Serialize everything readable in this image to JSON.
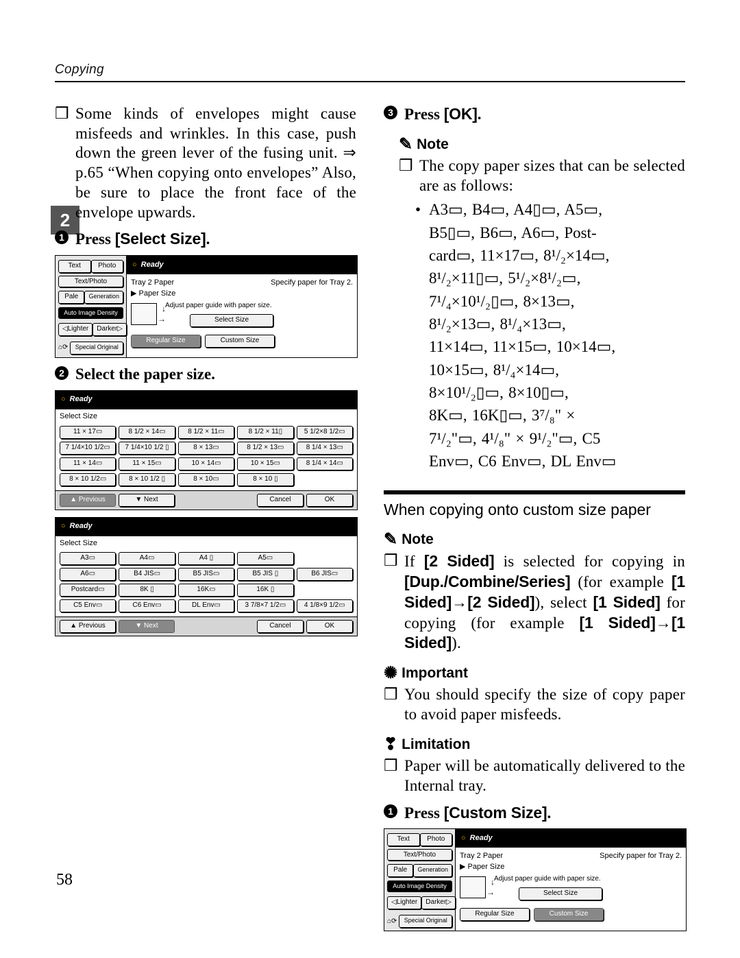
{
  "header": {
    "running_head": "Copying",
    "page_number": "58",
    "chapter_tab": "2"
  },
  "left": {
    "envelope_note": "Some kinds of envelopes might cause misfeeds and wrinkles. In this case, push down the green lever of the fusing unit. ⇒ p.65 “When copying onto envelopes” Also, be sure to place the front face of the envelope upwards.",
    "step1": {
      "prefix": "Press ",
      "bold": "[Select Size]",
      "suffix": "."
    },
    "step2": {
      "text": "Select the paper size."
    },
    "panel1": {
      "ready": "Ready",
      "side": {
        "seg_text": "Text",
        "seg_photo": "Photo",
        "btn_textphoto": "Text/Photo",
        "btn_pale": "Pale",
        "btn_generation": "Generation",
        "btn_aid": "Auto Image Density",
        "btn_lighter": "◁Lighter",
        "btn_darker": "Darker▷",
        "btn_special": "Special Original",
        "recall_icon": "⌂⟳"
      },
      "main": {
        "tray_label": "Tray 2 Paper",
        "specify": "Specify paper for Tray 2.",
        "paper_size_label": "Paper Size",
        "adjust_hint": "Adjust paper guide with paper size.",
        "btn_select_size": "Select Size",
        "btn_regular": "Regular Size",
        "btn_custom": "Custom Size"
      }
    },
    "panel2": {
      "ready": "Ready",
      "select_size_label": "Select Size",
      "grid": [
        "11 × 17▭",
        "8 1/2 × 14▭",
        "8 1/2 × 11▭",
        "8 1/2 × 11▯",
        "5 1/2×8 1/2▭",
        "7 1/4×10 1/2▭",
        "7 1/4×10 1/2 ▯",
        "8 × 13▭",
        "8 1/2 × 13▭",
        "8 1/4 × 13▭",
        "11 × 14▭",
        "11 × 15▭",
        "10 × 14▭",
        "10 × 15▭",
        "8 1/4 × 14▭",
        "8 × 10 1/2▭",
        "8 × 10 1/2 ▯",
        "8 × 10▭",
        "8 × 10 ▯",
        ""
      ],
      "btn_prev": "▲ Previous",
      "btn_next": "▼ Next",
      "btn_cancel": "Cancel",
      "btn_ok": "OK"
    },
    "panel3": {
      "ready": "Ready",
      "select_size_label": "Select Size",
      "grid": [
        "A3▭",
        "A4▭",
        "A4 ▯",
        "A5▭",
        "",
        "A6▭",
        "B4 JIS▭",
        "B5 JIS▭",
        "B5 JIS ▯",
        "B6 JIS▭",
        "Postcard▭",
        "8K ▯",
        "16K▭",
        "16K ▯",
        "",
        "C5 Env▭",
        "C6 Env▭",
        "DL Env▭",
        "3 7/8×7 1/2▭",
        "4 1/8×9 1/2▭"
      ],
      "btn_prev": "▲ Previous",
      "btn_next": "▼ Next",
      "btn_cancel": "Cancel",
      "btn_ok": "OK"
    }
  },
  "right": {
    "step3": {
      "prefix": "Press ",
      "bold": "[OK]",
      "suffix": "."
    },
    "note_label": "Note",
    "note_after_step3": "The copy paper sizes that can be selected are as follows:",
    "size_list_lines": [
      "A3▭, B4▭, A4▯▭, A5▭,",
      "B5▯▭, B6▭, A6▭, Post-",
      "card▭, 11×17▭, 8¹/₂×14▭,",
      "8¹/₂×11▯▭, 5¹/₂×8¹/₂▭,",
      "7¹/₄×10¹/₂▯▭, 8×13▭,",
      "8¹/₂×13▭, 8¹/₄×13▭,",
      "11×14▭, 11×15▭, 10×14▭,",
      "10×15▭, 8¹/₄×14▭,",
      "8×10¹/₂▯▭, 8×10▯▭,",
      "8K▭, 16K▯▭, 3⁷/₈\" ×",
      "7¹/₂\"▭, 4¹/₈\" × 9¹/₂\"▭, C5",
      "Env▭, C6 Env▭, DL Env▭"
    ],
    "custom_heading": "When copying onto custom size paper",
    "note2_text_parts": {
      "a": "If ",
      "b": "[2 Sided]",
      "c": " is selected for copying in ",
      "d": "[Dup./Combine/Series]",
      "e": " (for example ",
      "f": "[1 Sided]",
      "g": "→",
      "h": "[2 Sided]",
      "i": "), select ",
      "j": "[1 Sided]",
      "k": " for copying (for example ",
      "l": "[1 Sided]",
      "m": "→",
      "n": "[1 Sided]",
      "o": ")."
    },
    "important_label": "Important",
    "important_text": "You should specify the size of copy paper to avoid paper misfeeds.",
    "limitation_label": "Limitation",
    "limitation_text": "Paper will be automatically delivered to the Internal tray.",
    "step1": {
      "prefix": "Press ",
      "bold": "[Custom Size]",
      "suffix": "."
    },
    "panel4": {
      "ready": "Ready",
      "side": {
        "seg_text": "Text",
        "seg_photo": "Photo",
        "btn_textphoto": "Text/Photo",
        "btn_pale": "Pale",
        "btn_generation": "Generation",
        "btn_aid": "Auto Image Density",
        "btn_lighter": "◁Lighter",
        "btn_darker": "Darker▷",
        "btn_special": "Special Original",
        "recall_icon": "⌂⟳"
      },
      "main": {
        "tray_label": "Tray 2 Paper",
        "specify": "Specify paper for Tray 2.",
        "paper_size_label": "Paper Size",
        "adjust_hint": "Adjust paper guide with paper size.",
        "btn_select_size": "Select Size",
        "btn_regular": "Regular Size",
        "btn_custom": "Custom Size"
      }
    }
  }
}
